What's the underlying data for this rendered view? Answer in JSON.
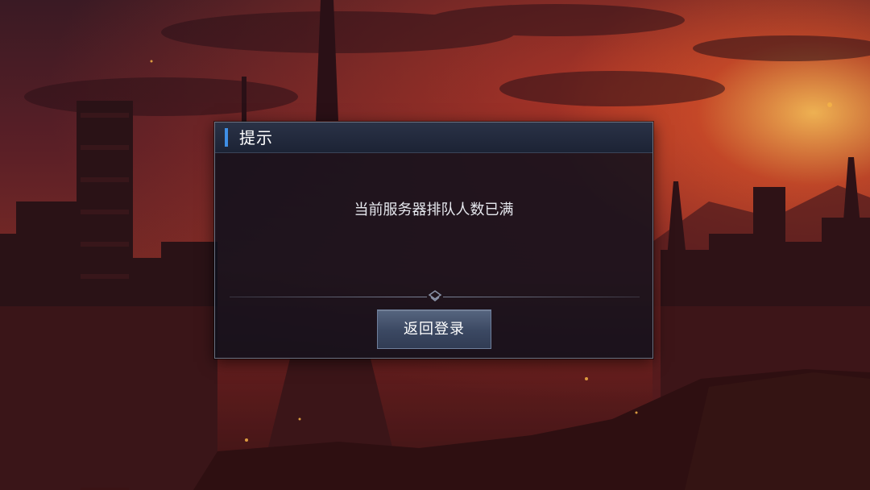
{
  "dialog": {
    "title": "提示",
    "message": "当前服务器排队人数已满",
    "button_label": "返回登录"
  },
  "colors": {
    "accent": "#3f8fe6",
    "dialog_bg": "#0c101c",
    "button_bg": "#3b4862",
    "sky_glow": "#e65a28"
  }
}
